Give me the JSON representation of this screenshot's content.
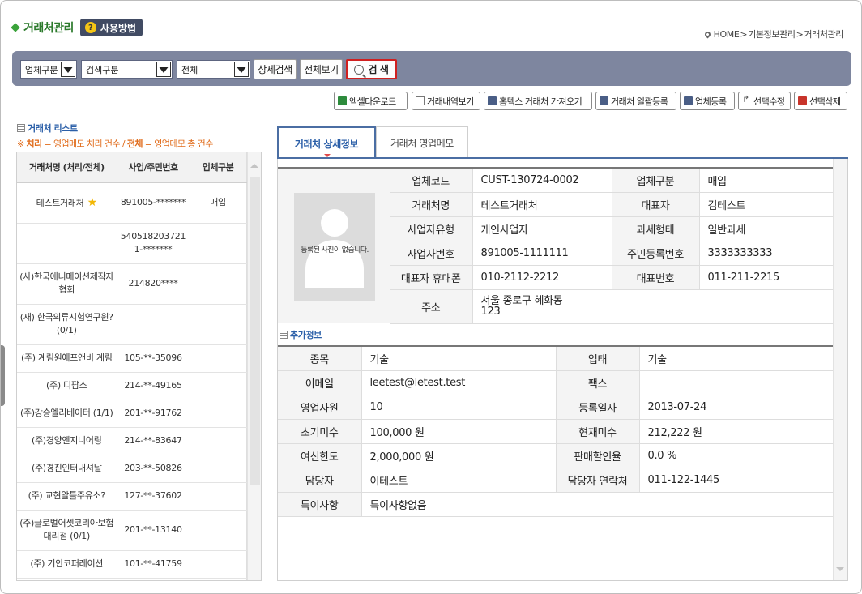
{
  "header": {
    "title": "거래처관리",
    "help_label": "사용방법"
  },
  "breadcrumb": {
    "home": "HOME",
    "sep": ">",
    "level1": "기본정보관리",
    "level2": "거래처관리"
  },
  "search": {
    "company_type": "업체구분",
    "search_type": "검색구분",
    "scope": "전체",
    "detail_btn": "상세검색",
    "all_btn": "전체보기",
    "search_btn": "검 색"
  },
  "toolbar": {
    "excel": "엑셀다운로드",
    "history": "거래내역보기",
    "hometax": "홈텍스 거래처 가져오기",
    "bulk": "거래처 일괄등록",
    "register": "업체등록",
    "edit": "선택수정",
    "delete": "선택삭제"
  },
  "list": {
    "title": "거래처 리스트",
    "note_prefix": "※ ",
    "note_a": "처리",
    "note_b": " = 영업메모 처리 건수 / ",
    "note_c": "전체",
    "note_d": " = 영업메모 총 건수",
    "columns": [
      "거래처명 (처리/전체)",
      "사업/주민번호",
      "업체구분"
    ],
    "rows": [
      {
        "name": "테스트거래처",
        "star": true,
        "biz": "891005-*******",
        "type": "매입"
      },
      {
        "name": "",
        "star": false,
        "biz": "5405182037211-*******",
        "type": ""
      },
      {
        "name": "(사)한국애니메이션제작자협회",
        "star": false,
        "biz": "214820****",
        "type": ""
      },
      {
        "name": "(재) 한국의류시험연구원? (0/1)",
        "star": false,
        "biz": "",
        "type": ""
      },
      {
        "name": "(주) 계림원에프앤비 계림",
        "star": false,
        "biz": "105-**-35096",
        "type": ""
      },
      {
        "name": "(주) 디팝스",
        "star": false,
        "biz": "214-**-49165",
        "type": ""
      },
      {
        "name": "(주)강승엘리베이터 (1/1)",
        "star": false,
        "biz": "201-**-91762",
        "type": ""
      },
      {
        "name": "(주)경양엔지니어링",
        "star": false,
        "biz": "214-**-83647",
        "type": ""
      },
      {
        "name": "(주)경진인터내셔날",
        "star": false,
        "biz": "203-**-50826",
        "type": ""
      },
      {
        "name": "(주) 교현알틀주유소?",
        "star": false,
        "biz": "127-**-37602",
        "type": ""
      },
      {
        "name": "(주)글로벌어셋코리아보험대리점 (0/1)",
        "star": false,
        "biz": "201-**-13140",
        "type": ""
      },
      {
        "name": "(주) 기안코퍼레이션",
        "star": false,
        "biz": "101-**-41759",
        "type": ""
      },
      {
        "name": "",
        "star": false,
        "biz": "",
        "type": ""
      }
    ]
  },
  "tabs": {
    "detail": "거래처 상세정보",
    "memo": "거래처 영업메모"
  },
  "detail": {
    "photo_text": "등록된 사진이 없습니다.",
    "company_code_label": "업체코드",
    "company_code": "CUST-130724-0002",
    "company_type_label": "업체구분",
    "company_type": "매입",
    "name_label": "거래처명",
    "name": "테스트거래처",
    "ceo_label": "대표자",
    "ceo": "김테스트",
    "biz_kind_label": "사업자유형",
    "biz_kind": "개인사업자",
    "tax_type_label": "과세형태",
    "tax_type": "일반과세",
    "biz_no_label": "사업자번호",
    "biz_no": "891005-1111111",
    "resident_no_label": "주민등록번호",
    "resident_no": "3333333333",
    "ceo_mobile_label": "대표자 휴대폰",
    "ceo_mobile": "010-2112-2212",
    "main_phone_label": "대표번호",
    "main_phone": "011-211-2215",
    "address_label": "주소",
    "address_line1": "서울 종로구 혜화동",
    "address_line2": "123"
  },
  "extra": {
    "title": "추가정보",
    "item_label": "종목",
    "item": "기술",
    "business_label": "업태",
    "business": "기술",
    "email_label": "이메일",
    "email": "leetest@letest.test",
    "fax_label": "팩스",
    "fax": "",
    "sales_label": "영업사원",
    "sales": "10",
    "reg_date_label": "등록일자",
    "reg_date": "2013-07-24",
    "init_unpaid_label": "초기미수",
    "init_unpaid": "100,000 원",
    "cur_unpaid_label": "현재미수",
    "cur_unpaid": "212,222 원",
    "credit_label": "여신한도",
    "credit": "2,000,000 원",
    "discount_label": "판매할인율",
    "discount": "0.0 %",
    "manager_label": "담당자",
    "manager": "이테스트",
    "manager_phone_label": "담당자 연락처",
    "manager_phone": "011-122-1445",
    "notes_label": "특이사항",
    "notes": "특이사항없음"
  }
}
